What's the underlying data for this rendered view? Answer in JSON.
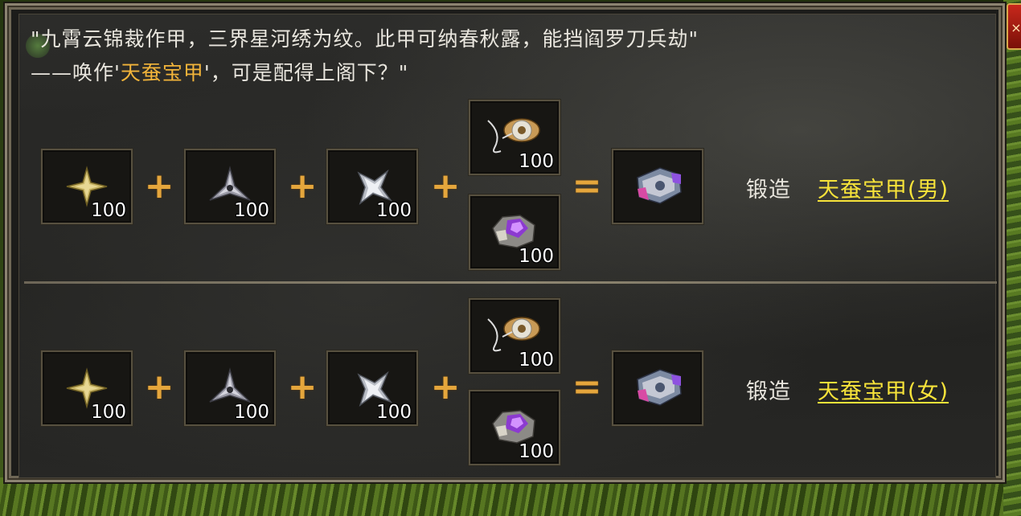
{
  "quote": {
    "line1": "\"九霄云锦裁作甲，三界星河绣为纹。此甲可纳春秋露，能挡阎罗刀兵劫\"",
    "line2_prefix": "——唤作'",
    "line2_highlight": "天蚕宝甲",
    "line2_suffix": "'，可是配得上阁下？\""
  },
  "close_button": {
    "label": "×"
  },
  "operators": {
    "plus": "+",
    "equals": "="
  },
  "recipes": [
    {
      "ingredients": [
        {
          "icon": "gold-four-point-star-icon",
          "qty": "100"
        },
        {
          "icon": "silver-triangle-star-icon",
          "qty": "100"
        },
        {
          "icon": "silver-shuriken-icon",
          "qty": "100"
        }
      ],
      "alternatives": [
        {
          "icon": "silk-thread-spool-icon",
          "qty": "100"
        },
        {
          "icon": "purple-crystal-ore-icon",
          "qty": "100"
        }
      ],
      "result_icon": "silkworm-armor-icon",
      "forge_label": "锻造",
      "result_name": "天蚕宝甲(男)"
    },
    {
      "ingredients": [
        {
          "icon": "gold-four-point-star-icon",
          "qty": "100"
        },
        {
          "icon": "silver-triangle-star-icon",
          "qty": "100"
        },
        {
          "icon": "silver-shuriken-icon",
          "qty": "100"
        }
      ],
      "alternatives": [
        {
          "icon": "silk-thread-spool-icon",
          "qty": "100"
        },
        {
          "icon": "purple-crystal-ore-icon",
          "qty": "100"
        }
      ],
      "result_icon": "silkworm-armor-icon",
      "forge_label": "锻造",
      "result_name": "天蚕宝甲(女)"
    }
  ],
  "colors": {
    "highlight": "#f2b43a",
    "link": "#f7e33a",
    "operator": "#e5a63c"
  }
}
